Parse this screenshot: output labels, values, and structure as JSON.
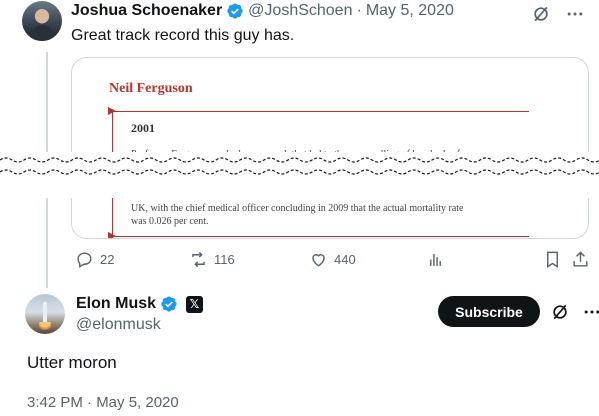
{
  "quoted_tweet": {
    "author_name": "Joshua Schoenaker",
    "handle": "@JoshSchoen",
    "separator": "·",
    "date": "May 5, 2020",
    "text": "Great track record this guy has.",
    "article": {
      "title": "Neil Ferguson",
      "year": "2001",
      "line_1": "Professor Ferguson worked on research that led to the mass culling of hundreds of",
      "line_2": "UK, with the chief medical officer concluding in 2009 that the actual mortality rate",
      "line_3": "was 0.026 per cent."
    },
    "actions": {
      "replies": "22",
      "reposts": "116",
      "likes": "440"
    }
  },
  "main_tweet": {
    "author_name": "Elon Musk",
    "badge_x": "𝕏",
    "handle": "@elonmusk",
    "subscribe_label": "Subscribe",
    "text": "Utter moron",
    "timestamp": "3:42 PM · May 5, 2020"
  },
  "colors": {
    "verified_blue": "#1d9bf0",
    "muted_text": "#536471",
    "article_red": "#b3362c"
  }
}
